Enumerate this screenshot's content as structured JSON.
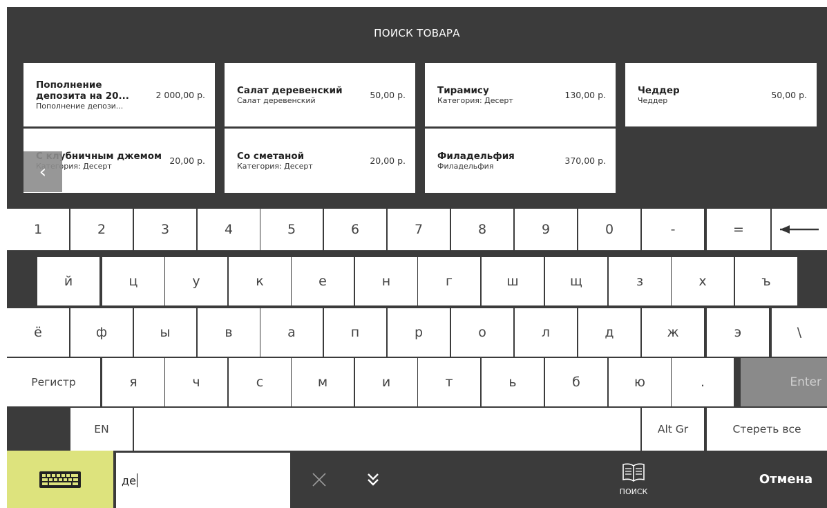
{
  "header": {
    "title": "ПОИСК ТОВАРА"
  },
  "products": [
    {
      "name": "Пополнение депозита на 20...",
      "desc": "Пополнение депози...",
      "price": "2 000,00 р."
    },
    {
      "name": "Салат деревенский",
      "desc": "Салат деревенский",
      "price": "50,00 р."
    },
    {
      "name": "Тирамису",
      "desc": "Категория: Десерт",
      "price": "130,00 р."
    },
    {
      "name": "Чеддер",
      "desc": "Чеддер",
      "price": "50,00 р."
    },
    {
      "name": "С клубничным джемом",
      "desc": "Категория: Десерт",
      "price": "20,00 р."
    },
    {
      "name": "Со сметаной",
      "desc": "Категория: Десерт",
      "price": "20,00 р."
    },
    {
      "name": "Филадельфия",
      "desc": "Филадельфия",
      "price": "370,00 р."
    }
  ],
  "keyboard": {
    "row1": [
      "1",
      "2",
      "3",
      "4",
      "5",
      "6",
      "7",
      "8",
      "9",
      "0",
      "-",
      "="
    ],
    "row2": [
      "й",
      "ц",
      "у",
      "к",
      "е",
      "н",
      "г",
      "ш",
      "щ",
      "з",
      "х",
      "ъ"
    ],
    "row3": [
      "ё",
      "ф",
      "ы",
      "в",
      "а",
      "п",
      "р",
      "о",
      "л",
      "д",
      "ж",
      "э",
      "\\"
    ],
    "row4": [
      "я",
      "ч",
      "с",
      "м",
      "и",
      "т",
      "ь",
      "б",
      "ю",
      "."
    ],
    "shift_label": "Регистр",
    "enter_label": "Enter",
    "lang_label": "EN",
    "altgr_label": "Alt Gr",
    "clear_all_label": "Стереть все",
    "backspace_icon": "arrow-left-icon"
  },
  "search": {
    "value": "де"
  },
  "toolbar": {
    "search_label": "ПОИСК",
    "cancel_label": "Отмена"
  },
  "colors": {
    "background": "#3b3b3b",
    "keyboard_toggle": "#dde37d",
    "enter_key": "#8a8a8a"
  }
}
